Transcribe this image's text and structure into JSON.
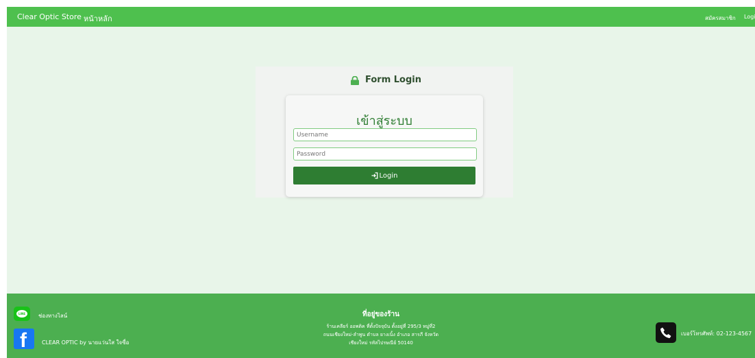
{
  "navbar": {
    "brand": "Clear Optic Store",
    "home": "หน้าหลัก",
    "register": "สมัครสมาชิก",
    "login": "Logi"
  },
  "login_panel": {
    "header": "Form Login",
    "card_title": "เข้าสู่ระบบ",
    "username_placeholder": "Username",
    "password_placeholder": "Password",
    "button_label": "Login"
  },
  "footer": {
    "line_label": "ช่องทางไลน์",
    "line_icon_text": "LINE",
    "facebook_label": "CLEAR OPTIC by นายแว่นใส ใจซื่อ",
    "address_title": "ที่อยู่ของร้าน",
    "address_lines": [
      "ร้านเคลียร์ ออพติค ที่ตั้งปัจจุบัน ตั้งอยู่ที่ 295/3 หมู่ที่2",
      "ถนนเชียงใหม่-ลำพูน ตำบล ยางเนิ้ง อำเภอ สารภี จังหวัด",
      "เชียงใหม่ รหัสไปรษณีย์ 50140"
    ],
    "phone_label": "เบอร์โทรศัพท์: 02-123-4567"
  },
  "colors": {
    "nav_green": "#4ec04e",
    "page_bg": "#e8f5e9",
    "button_green": "#2e7d32",
    "footer_green": "#4caf50"
  }
}
